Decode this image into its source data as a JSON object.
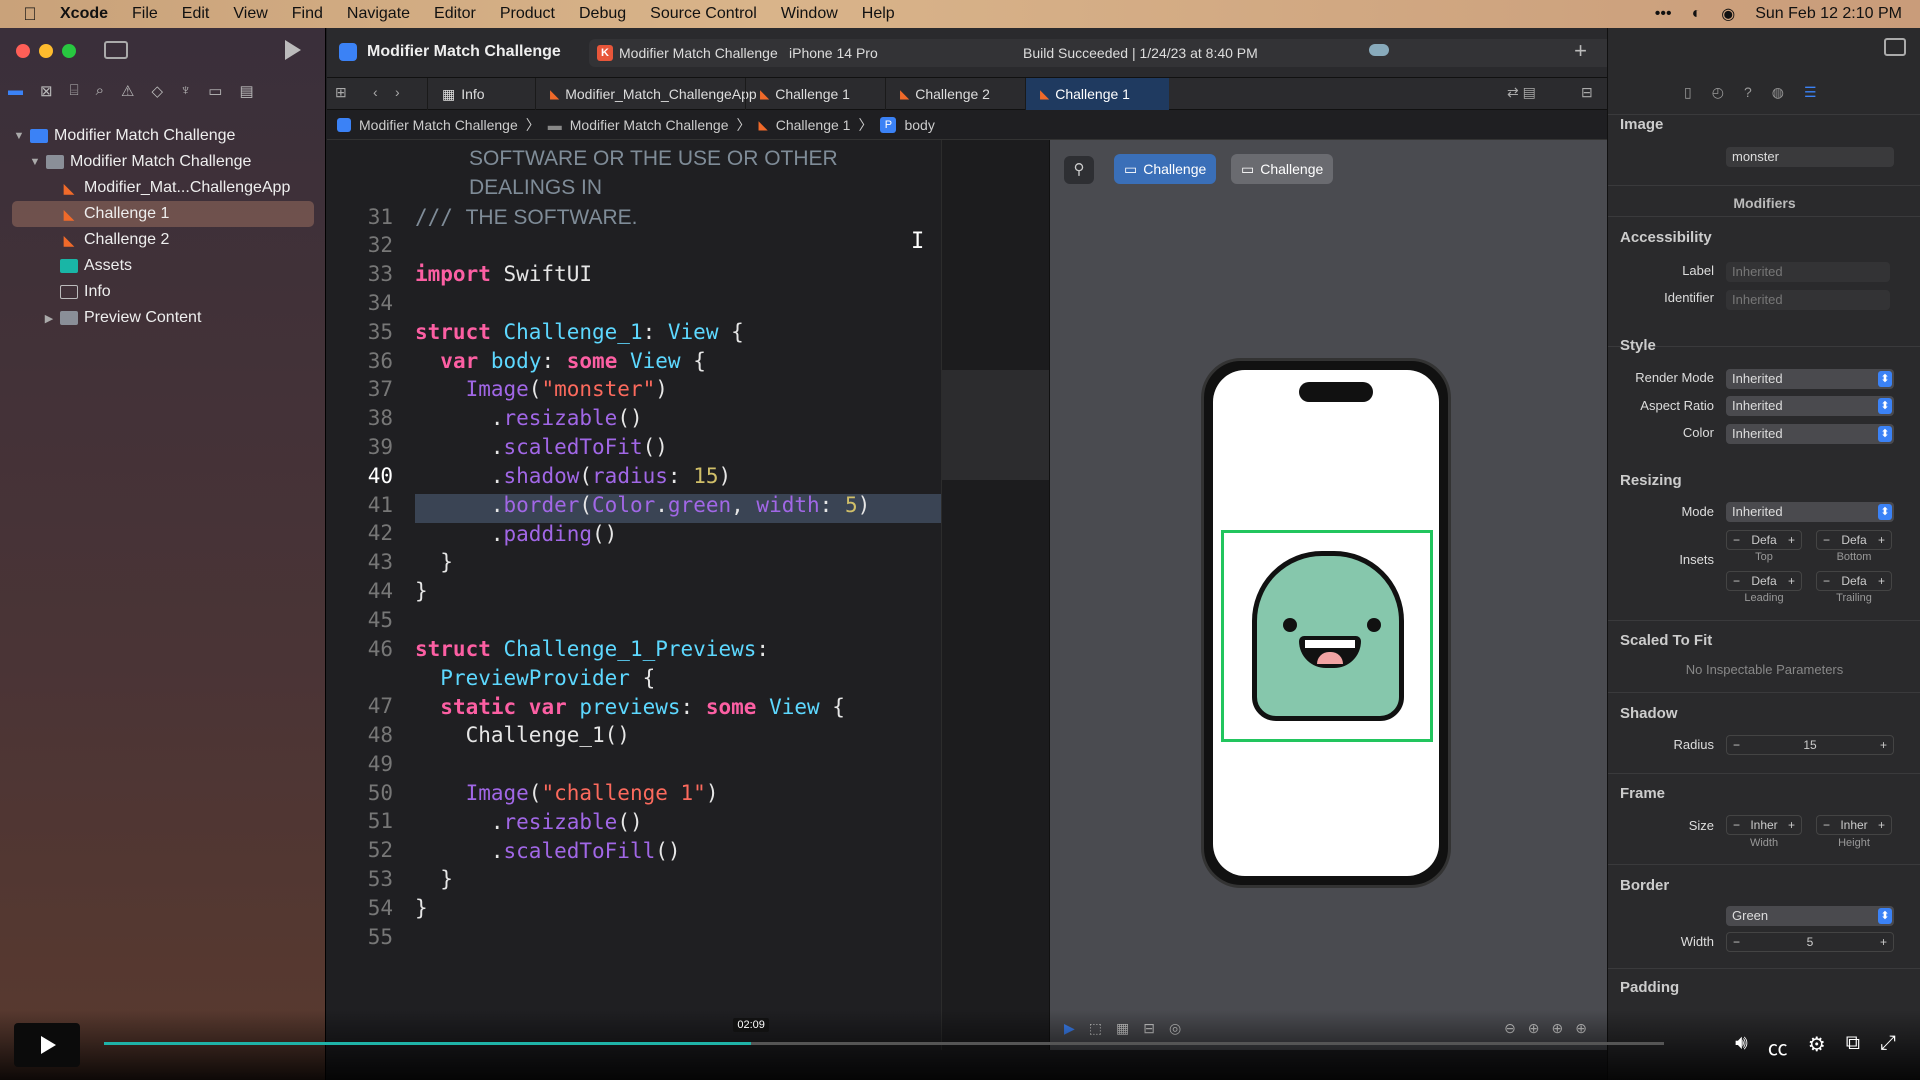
{
  "menubar": {
    "app": "Xcode",
    "items": [
      "File",
      "Edit",
      "View",
      "Find",
      "Navigate",
      "Editor",
      "Product",
      "Debug",
      "Source Control",
      "Window",
      "Help"
    ],
    "clock": "Sun Feb 12  2:10 PM"
  },
  "toolbar": {
    "project": "Modifier Match Challenge",
    "scheme": "Modifier Match Challenge",
    "device": "iPhone 14 Pro",
    "build_status": "Build Succeeded | 1/24/23 at 8:40 PM"
  },
  "navigator": {
    "items": [
      {
        "label": "Modifier Match Challenge"
      },
      {
        "label": "Modifier Match Challenge"
      },
      {
        "label": "Modifier_Mat...ChallengeApp"
      },
      {
        "label": "Challenge 1"
      },
      {
        "label": "Challenge 2"
      },
      {
        "label": "Assets"
      },
      {
        "label": "Info"
      },
      {
        "label": "Preview Content"
      }
    ]
  },
  "tabs": [
    "Info",
    "Modifier_Match_ChallengeApp",
    "Challenge 1",
    "Challenge 2",
    "Challenge 1"
  ],
  "jumpbar": [
    "Modifier Match Challenge",
    "Modifier Match Challenge",
    "Challenge 1",
    "body"
  ],
  "code": {
    "line_numbers": [
      "",
      "",
      "31",
      "32",
      "33",
      "34",
      "35",
      "36",
      "37",
      "38",
      "39",
      "40",
      "41",
      "42",
      "43",
      "44",
      "45",
      "46",
      "",
      "47",
      "48",
      "49",
      "50",
      "51",
      "52",
      "53",
      "54",
      "55"
    ],
    "comment1": "SOFTWARE OR THE USE OR OTHER",
    "comment2": "DEALINGS IN",
    "comment3": "THE SOFTWARE."
  },
  "canvas": {
    "pill1": "Challenge",
    "pill2": "Challenge"
  },
  "inspector": {
    "image_header": "Image",
    "image_value": "monster",
    "modifiers": "Modifiers",
    "accessibility": "Accessibility",
    "label": "Label",
    "identifier": "Identifier",
    "inherited": "Inherited",
    "style": "Style",
    "render_mode": "Render Mode",
    "aspect_ratio": "Aspect Ratio",
    "color": "Color",
    "resizing": "Resizing",
    "mode": "Mode",
    "insets": "Insets",
    "defa": "Defa",
    "top": "Top",
    "bottom": "Bottom",
    "leading": "Leading",
    "trailing": "Trailing",
    "scaled_to_fit": "Scaled To Fit",
    "no_params": "No Inspectable Parameters",
    "shadow": "Shadow",
    "radius": "Radius",
    "radius_value": "15",
    "frame": "Frame",
    "size": "Size",
    "inher": "Inher",
    "width": "Width",
    "height": "Height",
    "border": "Border",
    "border_color": "Green",
    "border_width": "5",
    "padding": "Padding"
  },
  "video": {
    "time": "02:09",
    "progress_fraction": 0.415
  }
}
